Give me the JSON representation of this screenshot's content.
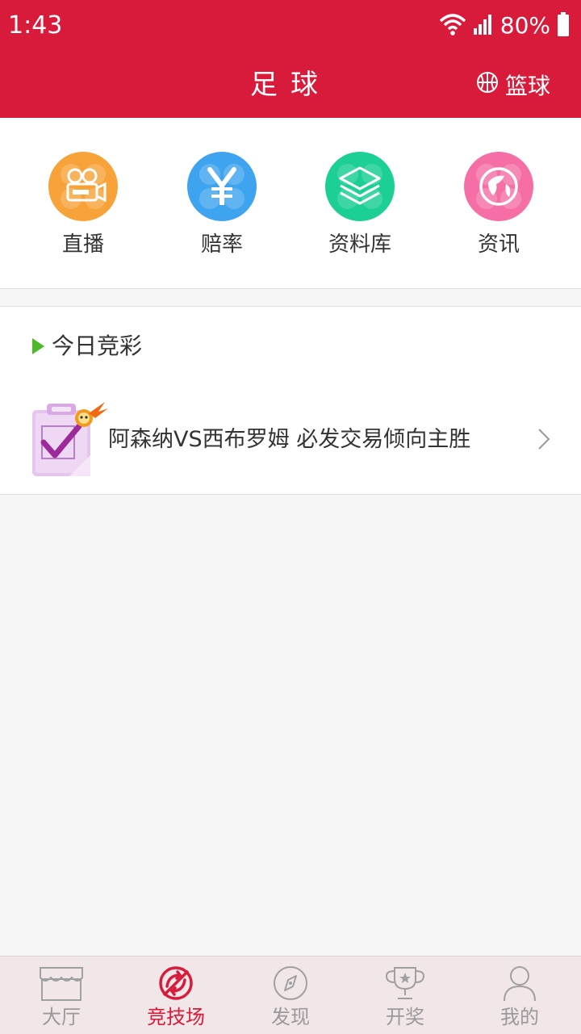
{
  "status_bar": {
    "time": "1:43",
    "battery": "80%",
    "icons": [
      "wifi-icon",
      "signal-icon",
      "battery-icon"
    ]
  },
  "header": {
    "title": "足球",
    "switch_label": "篮球",
    "switch_icon": "basketball-icon",
    "background": "#d81b3a"
  },
  "menu": {
    "items": [
      {
        "label": "直播",
        "icon": "video-camera-icon",
        "color": "#f7a33a"
      },
      {
        "label": "赔率",
        "icon": "yen-icon",
        "color": "#3fa4f0"
      },
      {
        "label": "资料库",
        "icon": "layers-icon",
        "color": "#1ccf94"
      },
      {
        "label": "资讯",
        "icon": "news-globe-icon",
        "color": "#f56fa6"
      }
    ]
  },
  "section": {
    "title": "今日竞彩",
    "accent": "#4fb82a"
  },
  "list": {
    "items": [
      {
        "text": "阿森纳VS西布罗姆 必发交易倾向主胜",
        "icon": "checklist-fire-icon"
      }
    ]
  },
  "bottom_nav": {
    "items": [
      {
        "label": "大厅",
        "icon": "store-icon",
        "active": false
      },
      {
        "label": "竞技场",
        "icon": "arena-icon",
        "active": true
      },
      {
        "label": "发现",
        "icon": "compass-icon",
        "active": false
      },
      {
        "label": "开奖",
        "icon": "trophy-icon",
        "active": false
      },
      {
        "label": "我的",
        "icon": "user-icon",
        "active": false
      }
    ],
    "active_color": "#d81b3a"
  }
}
